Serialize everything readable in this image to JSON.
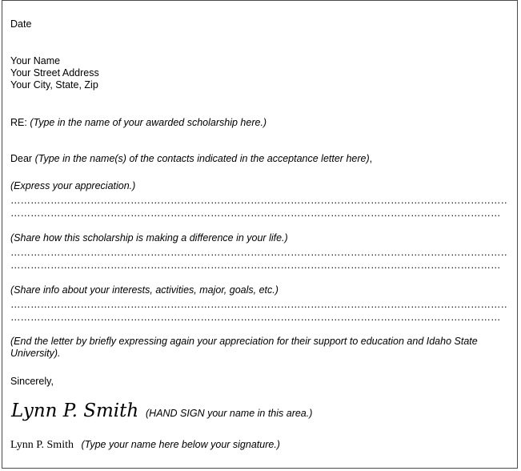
{
  "letter": {
    "date": "Date",
    "sender": {
      "name": "Your Name",
      "street": "Your Street Address",
      "city": "Your City, State, Zip"
    },
    "re_label": "RE:",
    "re_note": "(Type in the name of your awarded scholarship here.)",
    "dear_label": "Dear",
    "dear_note": "(Type in the name(s) of the contacts indicated in the acceptance letter here)",
    "dear_punct": ",",
    "sections": [
      {
        "prompt": "(Express your appreciation.)",
        "line1": "…………………………………………………………………………………………………………………………………………",
        "line2": "……………………………………………………………………………………………………………………………………"
      },
      {
        "prompt": "(Share how this scholarship is making a difference in your life.)",
        "line1": "…………………………………………………………………………………………………………………………………………",
        "line2": "……………………………………………………………………………………………………………………………………"
      },
      {
        "prompt": "(Share info about your interests, activities, major, goals, etc.)",
        "line1": "…………………………………………………………………………………………………………………………………………",
        "line2": "……………………………………………………………………………………………………………………………………"
      }
    ],
    "closing_note_line1": "(End the letter by briefly expressing again your appreciation for their support to education and Idaho State",
    "closing_note_line2": "University).",
    "sign_off": "Sincerely,",
    "signature": "Lynn P. Smith",
    "signature_note": "(HAND SIGN your name in this area.)",
    "typed_name": "Lynn P. Smith",
    "typed_note": "(Type your name here below your signature.)"
  }
}
